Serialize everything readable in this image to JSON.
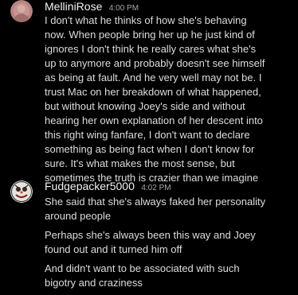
{
  "messages": [
    {
      "username": "MelliniRose",
      "timestamp": "4:00 PM",
      "lines": [
        "I don't what he thinks of how she's behaving",
        "now. When people bring her up he just kind of",
        "ignores I don't think he really cares what she's",
        "up to anymore and probably doesn't see himself",
        "as being at fault. And he very well may not be. I",
        "trust Mac on her breakdown of what happened,",
        "but without knowing Joey's side and without",
        "hearing her own explanation of her descent into",
        "this right wing fanfare, I don't want to declare",
        "something as being fact when I don't know for",
        "sure. It's what makes the most sense, but",
        "sometimes the truth is crazier than we imagine"
      ]
    },
    {
      "username": "Fudgepacker5000",
      "timestamp": "4:02 PM",
      "paragraphs": [
        {
          "lines": [
            "She said that she's always faked her personality",
            "around people"
          ]
        },
        {
          "lines": [
            "Perhaps she's always been this way and Joey",
            "found out and it turned him off"
          ]
        },
        {
          "lines": [
            "And didn't want to be associated with such",
            "bigotry and craziness"
          ]
        }
      ]
    }
  ],
  "colors": {
    "background": "#000000",
    "username": "#f2f3f5",
    "text": "#dcddde",
    "timestamp": "#a3a6aa"
  }
}
